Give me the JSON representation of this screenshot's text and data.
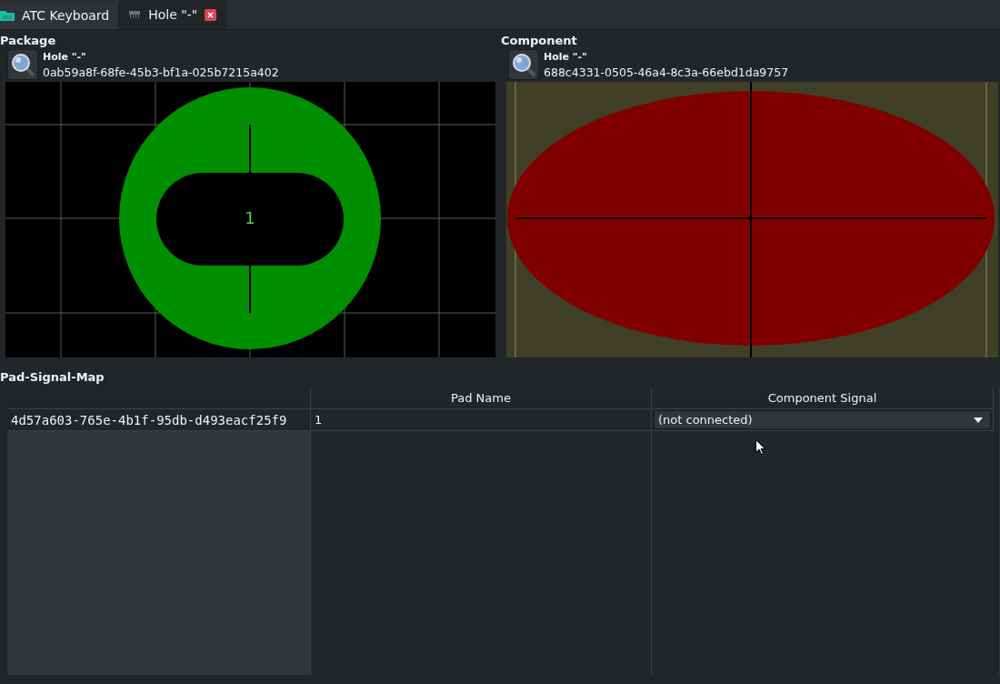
{
  "tabs": [
    {
      "label": "ATC Keyboard",
      "kind": "folder",
      "selected": false,
      "closable": false
    },
    {
      "label": "Hole \"-\"",
      "kind": "footprint",
      "selected": true,
      "closable": true
    }
  ],
  "package": {
    "title": "Package",
    "name": "Hole \"-\"",
    "uuid": "0ab59a8f-68fe-45b3-bf1a-025b7215a402",
    "pad_label": "1"
  },
  "component": {
    "title": "Component",
    "name": "Hole \"-\"",
    "uuid": "688c4331-0505-46a4-8c3a-66ebd1da9757"
  },
  "pad_signal_map": {
    "title": "Pad-Signal-Map",
    "columns": [
      "Pad Name",
      "Component Signal"
    ],
    "rows": [
      {
        "row_header": "4d57a603-765e-4b1f-95db-d493eacf25f9",
        "pad_name": "1",
        "signal": "(not connected)"
      }
    ]
  }
}
